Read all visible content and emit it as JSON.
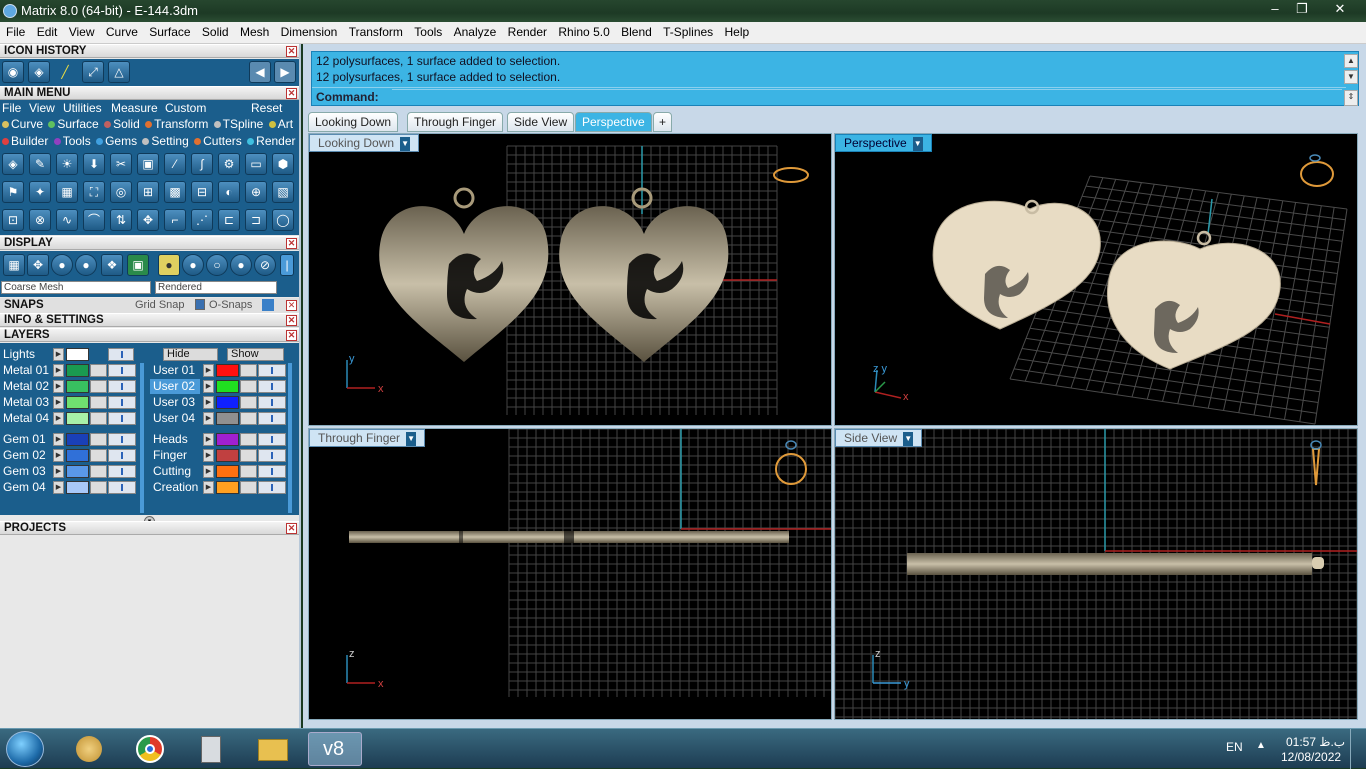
{
  "window": {
    "title": "Matrix 8.0 (64-bit) - E-144.3dm",
    "min": "–",
    "max": "❐",
    "close": "✕"
  },
  "menu": [
    "File",
    "Edit",
    "View",
    "Curve",
    "Surface",
    "Solid",
    "Mesh",
    "Dimension",
    "Transform",
    "Tools",
    "Analyze",
    "Render",
    "Rhino 5.0",
    "Blend",
    "T-Splines",
    "Help"
  ],
  "panels": {
    "icon_history": "ICON HISTORY",
    "main_menu": "MAIN MENU",
    "display": "DISPLAY",
    "snaps": "SNAPS",
    "info": "INFO & SETTINGS",
    "layers": "LAYERS",
    "projects": "PROJECTS"
  },
  "main_menu_items": [
    "File",
    "View",
    "Utilities",
    "Measure",
    "Custom",
    "Reset"
  ],
  "builder_row1": [
    {
      "label": "Curve",
      "color": "#d8c060"
    },
    {
      "label": "Surface",
      "color": "#60c060"
    },
    {
      "label": "Solid",
      "color": "#c06060"
    },
    {
      "label": "Transform",
      "color": "#e07030"
    },
    {
      "label": "TSpline",
      "color": "#c0c0c0"
    },
    {
      "label": "Art",
      "color": "#d0c040"
    }
  ],
  "builder_row2": [
    {
      "label": "Builder",
      "color": "#e04040"
    },
    {
      "label": "Tools",
      "color": "#9040c0"
    },
    {
      "label": "Gems",
      "color": "#40a0e0"
    },
    {
      "label": "Setting",
      "color": "#c0c0c0"
    },
    {
      "label": "Cutters",
      "color": "#e07030"
    },
    {
      "label": "Render",
      "color": "#40c0e0"
    }
  ],
  "display": {
    "mesh": "Coarse Mesh",
    "mode": "Rendered"
  },
  "snaps": {
    "grid": "Grid Snap",
    "osnap": "O-Snaps"
  },
  "layers": {
    "lights": "Lights",
    "hide": "Hide",
    "show": "Show",
    "left": [
      {
        "name": "Metal 01",
        "color": "#1a9a50"
      },
      {
        "name": "Metal 02",
        "color": "#38c060"
      },
      {
        "name": "Metal 03",
        "color": "#70e070"
      },
      {
        "name": "Metal 04",
        "color": "#a8f0a8"
      },
      {
        "name": "Gem 01",
        "color": "#1a40b8"
      },
      {
        "name": "Gem 02",
        "color": "#3070d8"
      },
      {
        "name": "Gem 03",
        "color": "#5a98e8"
      },
      {
        "name": "Gem 04",
        "color": "#a8c8f8"
      }
    ],
    "right": [
      {
        "name": "User 01",
        "color": "#ff1010"
      },
      {
        "name": "User 02",
        "color": "#20e020"
      },
      {
        "name": "User 03",
        "color": "#1020ff"
      },
      {
        "name": "User 04",
        "color": "#909090"
      },
      {
        "name": "Heads",
        "color": "#a020d0"
      },
      {
        "name": "Finger",
        "color": "#c04040"
      },
      {
        "name": "Cutting",
        "color": "#ff7010"
      },
      {
        "name": "Creation",
        "color": "#ffa020"
      }
    ]
  },
  "command": {
    "line1": "12 polysurfaces, 1 surface added to selection.",
    "line2": "12 polysurfaces, 1 surface added to selection.",
    "label": "Command:",
    "value": ""
  },
  "tabs": [
    "Looking Down",
    "Through Finger",
    "Side View",
    "Perspective",
    "+"
  ],
  "viewports": [
    {
      "name": "Looking Down",
      "axis_a": "y",
      "axis_b": "x"
    },
    {
      "name": "Perspective",
      "axis_a": "z y",
      "axis_b": "x"
    },
    {
      "name": "Through Finger",
      "axis_a": "z",
      "axis_b": "x"
    },
    {
      "name": "Side View",
      "axis_a": "z",
      "axis_b": "y"
    }
  ],
  "taskbar": {
    "lang": "EN",
    "time": "01:57 ب.ظ",
    "date": "12/08/2022",
    "active_app": "v8"
  }
}
